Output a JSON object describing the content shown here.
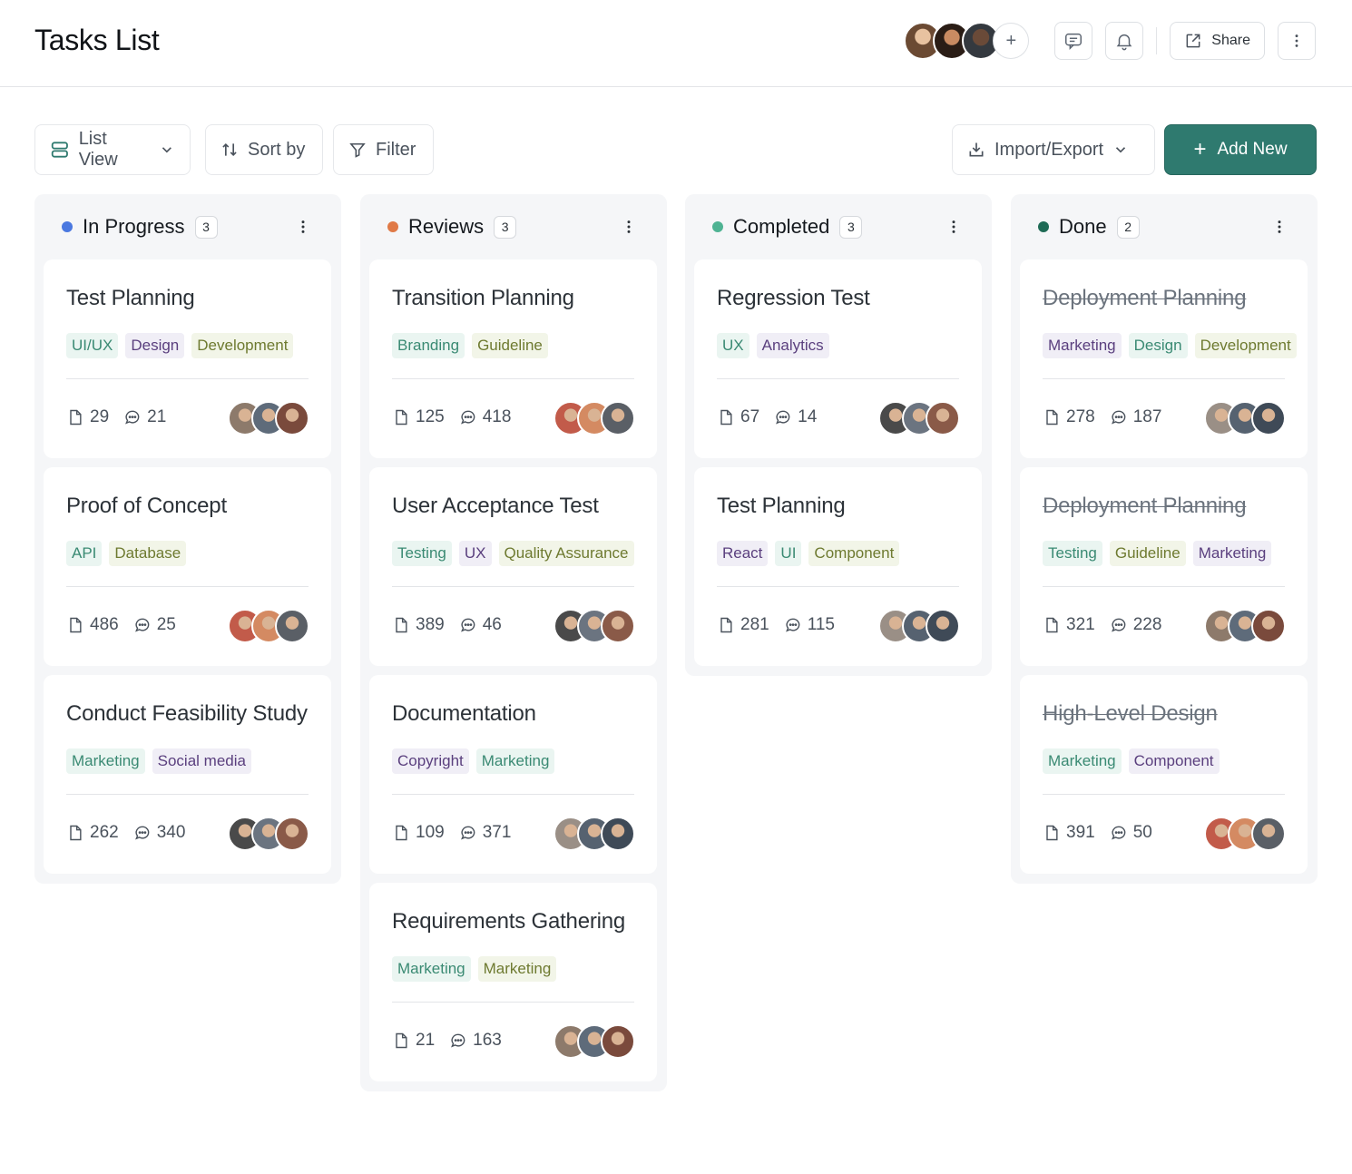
{
  "header": {
    "title": "Tasks List",
    "share_label": "Share"
  },
  "toolbar": {
    "view_label": "List View",
    "sort_label": "Sort by",
    "filter_label": "Filter",
    "import_label": "Import/Export",
    "add_label": "Add New"
  },
  "colors": {
    "accent": "#2f7a6f",
    "in_progress": "#4a78e0",
    "reviews": "#e07a47",
    "completed": "#4fb393",
    "done": "#1f6b56"
  },
  "columns": [
    {
      "title": "In Progress",
      "count": "3",
      "cards": [
        {
          "title": "Test Planning",
          "tags": [
            "UI/UX",
            "Design",
            "Development"
          ],
          "files": "29",
          "comments": "21"
        },
        {
          "title": "Proof of Concept",
          "tags": [
            "API",
            "Database"
          ],
          "files": "486",
          "comments": "25"
        },
        {
          "title": "Conduct Feasibility Study",
          "tags": [
            "Marketing",
            "Social media"
          ],
          "files": "262",
          "comments": "340"
        }
      ]
    },
    {
      "title": "Reviews",
      "count": "3",
      "cards": [
        {
          "title": "Transition Planning",
          "tags": [
            "Branding",
            "Guideline"
          ],
          "files": "125",
          "comments": "418"
        },
        {
          "title": "User Acceptance Test",
          "tags": [
            "Testing",
            "UX",
            "Quality Assurance"
          ],
          "files": "389",
          "comments": "46"
        },
        {
          "title": "Documentation",
          "tags": [
            "Copyright",
            "Marketing"
          ],
          "files": "109",
          "comments": "371"
        },
        {
          "title": "Requirements Gathering",
          "tags": [
            "Marketing",
            "Marketing"
          ],
          "files": "21",
          "comments": "163"
        }
      ]
    },
    {
      "title": "Completed",
      "count": "3",
      "cards": [
        {
          "title": "Regression Test",
          "tags": [
            "UX",
            "Analytics"
          ],
          "files": "67",
          "comments": "14"
        },
        {
          "title": "Test Planning",
          "tags": [
            "React",
            "UI",
            "Component"
          ],
          "files": "281",
          "comments": "115"
        }
      ]
    },
    {
      "title": "Done",
      "count": "2",
      "cards": [
        {
          "title": "Deployment Planning",
          "tags": [
            "Marketing",
            "Design",
            "Development"
          ],
          "files": "278",
          "comments": "187"
        },
        {
          "title": "Deployment Planning",
          "tags": [
            "Testing",
            "Guideline",
            "Marketing"
          ],
          "files": "321",
          "comments": "228"
        },
        {
          "title": "High-Level Design",
          "tags": [
            "Marketing",
            "Component"
          ],
          "files": "391",
          "comments": "50"
        }
      ]
    }
  ]
}
